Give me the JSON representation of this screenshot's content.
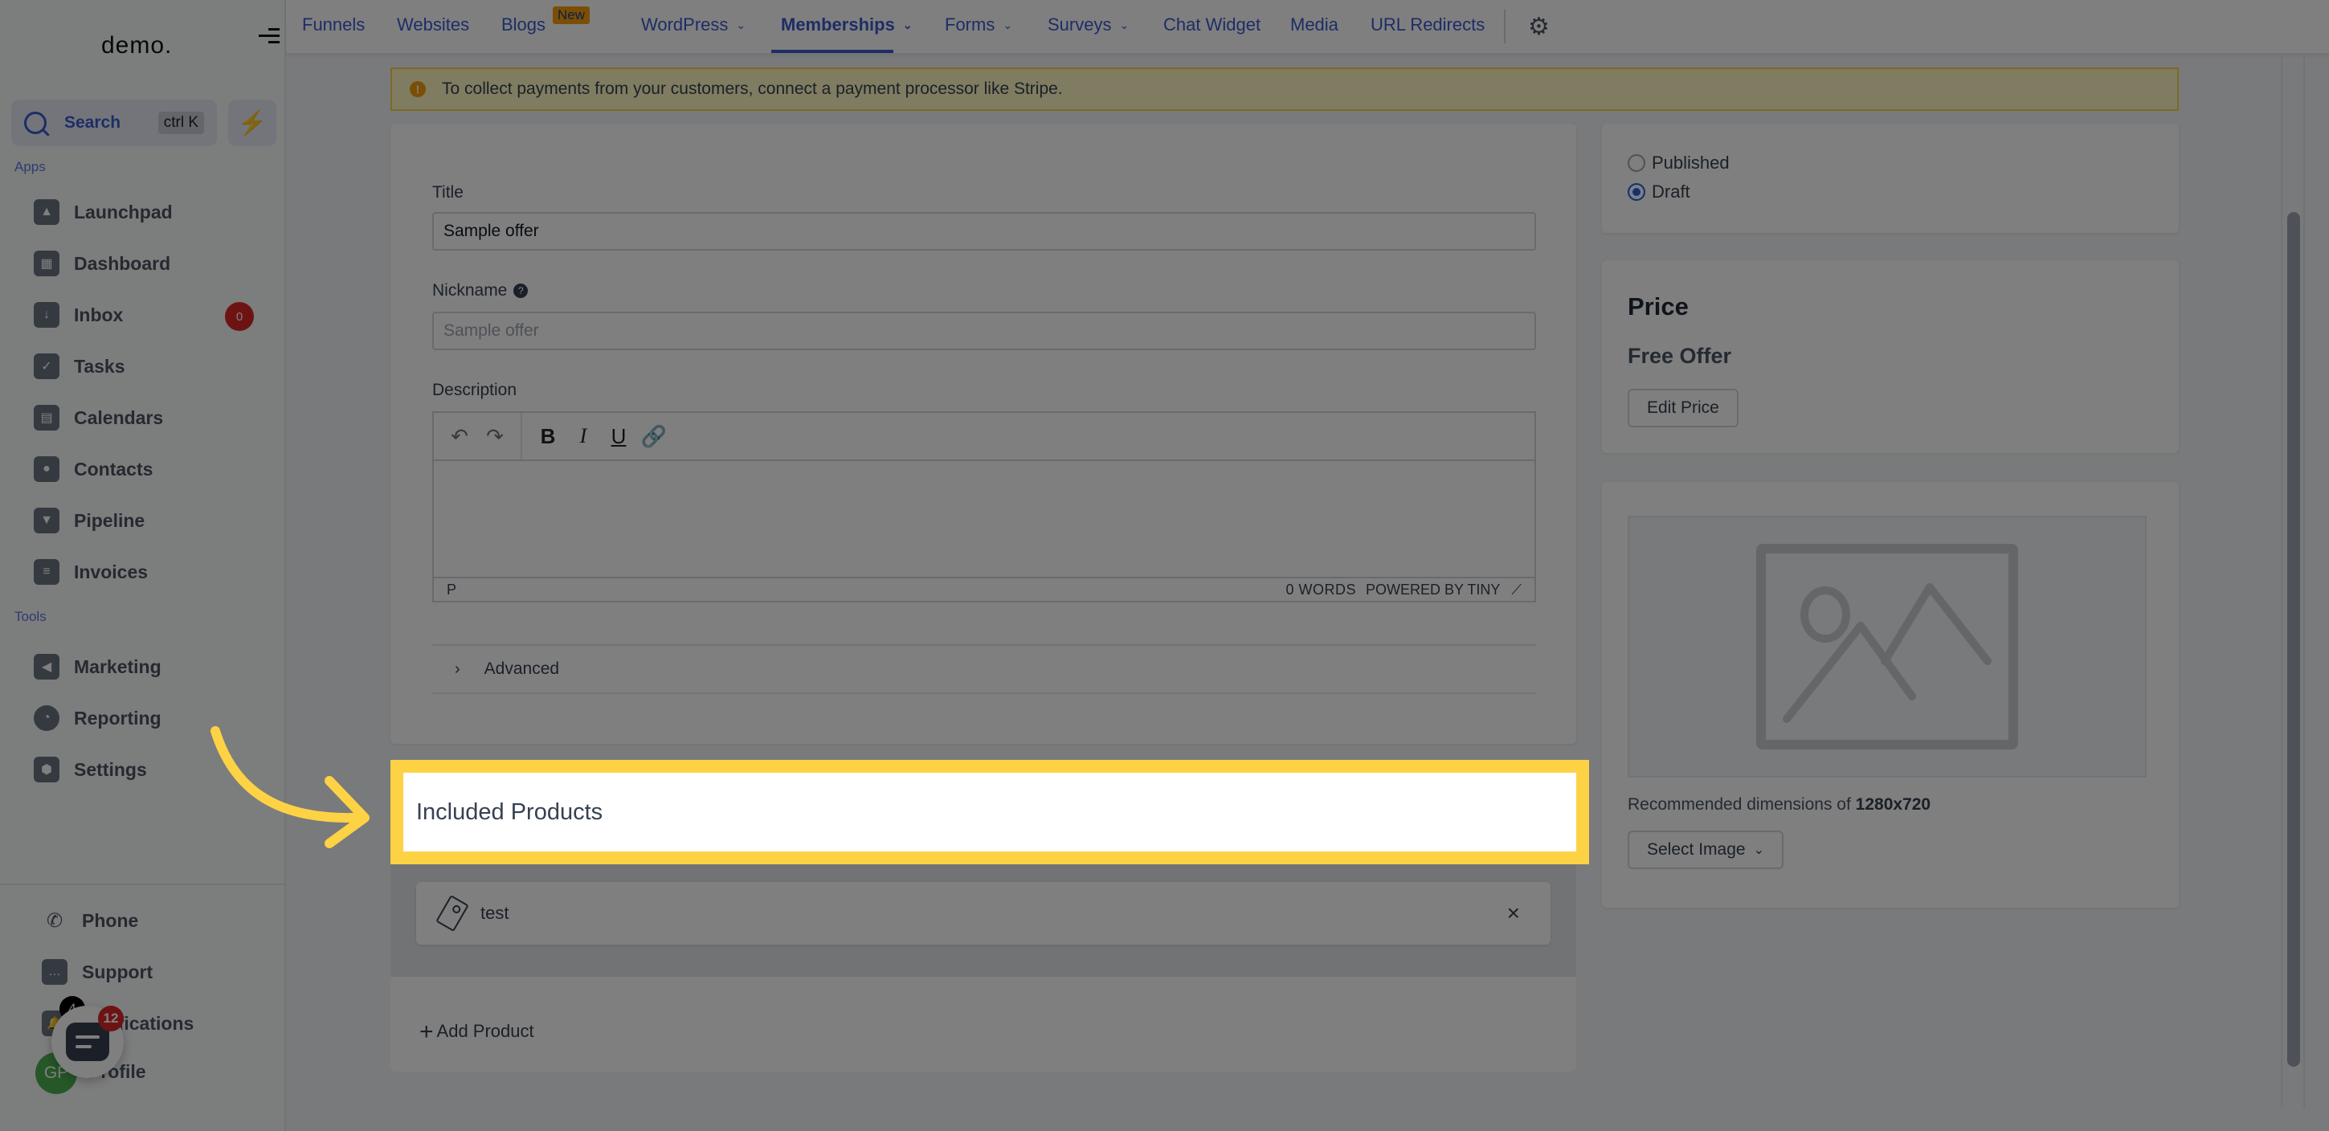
{
  "sidebar": {
    "logo": "demo.",
    "search": {
      "label": "Search",
      "shortcut": "ctrl K"
    },
    "apps_label": "Apps",
    "apps": [
      {
        "label": "Launchpad",
        "icon": "rocket-icon"
      },
      {
        "label": "Dashboard",
        "icon": "grid-icon"
      },
      {
        "label": "Inbox",
        "icon": "inbox-icon",
        "badge": "0"
      },
      {
        "label": "Tasks",
        "icon": "clipboard-check-icon"
      },
      {
        "label": "Calendars",
        "icon": "calendar-icon"
      },
      {
        "label": "Contacts",
        "icon": "user-icon"
      },
      {
        "label": "Pipeline",
        "icon": "funnel-icon"
      },
      {
        "label": "Invoices",
        "icon": "receipt-icon"
      }
    ],
    "tools_label": "Tools",
    "tools": [
      {
        "label": "Marketing",
        "icon": "megaphone-icon"
      },
      {
        "label": "Reporting",
        "icon": "pie-chart-icon"
      },
      {
        "label": "Settings",
        "icon": "gear-icon"
      }
    ],
    "bottom": [
      {
        "label": "Phone",
        "icon": "phone-icon"
      },
      {
        "label": "Support",
        "icon": "chat-icon"
      },
      {
        "label": "Notifications",
        "icon": "bell-icon",
        "badge": "4"
      },
      {
        "label": "Profile",
        "avatar": "GP"
      }
    ],
    "chat_widget_badge": "12"
  },
  "topnav": {
    "tabs": [
      {
        "label": "Funnels"
      },
      {
        "label": "Websites"
      },
      {
        "label": "Blogs",
        "badge": "New"
      },
      {
        "label": "WordPress",
        "dropdown": true
      },
      {
        "label": "Memberships",
        "dropdown": true,
        "active": true
      },
      {
        "label": "Forms",
        "dropdown": true
      },
      {
        "label": "Surveys",
        "dropdown": true
      },
      {
        "label": "Chat Widget"
      },
      {
        "label": "Media"
      },
      {
        "label": "URL Redirects"
      }
    ]
  },
  "alert": {
    "text": "To collect payments from your customers, connect a payment processor like Stripe."
  },
  "form": {
    "title_label": "Title",
    "title_value": "Sample offer",
    "nickname_label": "Nickname",
    "nickname_placeholder": "Sample offer",
    "description_label": "Description",
    "editor": {
      "status_left": "P",
      "word_count": "0 WORDS",
      "powered_by": "POWERED BY TINY"
    },
    "advanced_label": "Advanced"
  },
  "included_products": {
    "title": "Included Products",
    "items": [
      {
        "name": "test"
      }
    ],
    "add_label": "Add Product"
  },
  "status": {
    "options": [
      {
        "label": "Published",
        "checked": false
      },
      {
        "label": "Draft",
        "checked": true
      }
    ]
  },
  "price": {
    "title": "Price",
    "value": "Free Offer",
    "edit_label": "Edit Price"
  },
  "image": {
    "recommended_prefix": "Recommended dimensions of",
    "recommended_dims": "1280x720",
    "select_label": "Select Image"
  },
  "colors": {
    "accent": "#3b5bcc",
    "highlight": "#fdd245",
    "badge_red": "#dc2626",
    "alert_bg": "#fef9c3"
  }
}
